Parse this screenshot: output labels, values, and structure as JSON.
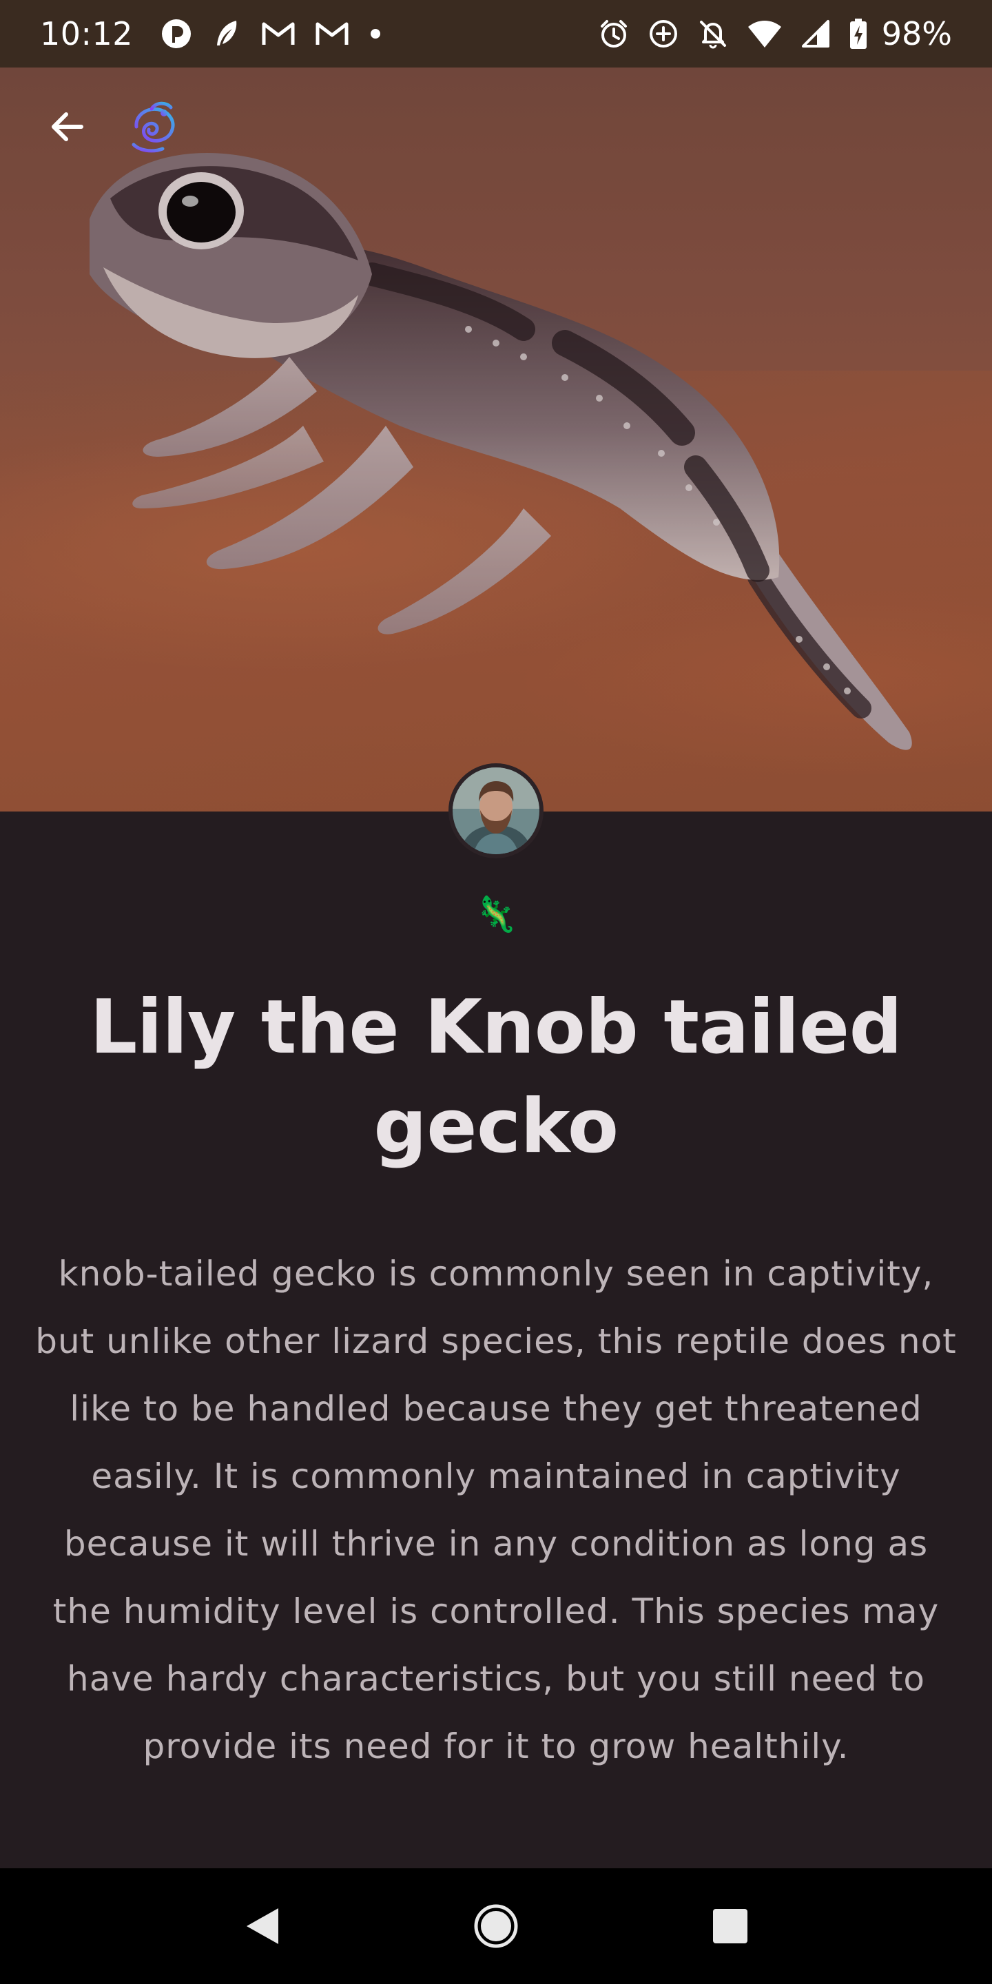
{
  "status_bar": {
    "time": "10:12",
    "battery_percent": "98%",
    "left_icons": [
      "brand-app-icon",
      "feather-icon",
      "gmail-icon",
      "gmail-icon",
      "notification-dot-icon"
    ],
    "right_icons": [
      "alarm-icon",
      "data-saver-icon",
      "notifications-off-icon",
      "wifi-icon",
      "cell-signal-icon",
      "battery-charging-icon"
    ]
  },
  "hero": {
    "back_icon": "arrow-back-icon",
    "logo_icon": "chameleon-logo-icon"
  },
  "post": {
    "emoji": "🦎",
    "title": "Lily the Knob tailed gecko",
    "body": "knob-tailed gecko is commonly seen in captivity, but unlike other lizard species, this reptile does not like to be handled because they get threatened easily. It is commonly maintained in captivity because it will thrive in any condition as long as the humidity level is controlled. This species may have hardy characteristics, but you still need to provide its need for it to grow healthily."
  },
  "nav_bar": {
    "back": "nav-back-icon",
    "home": "nav-home-icon",
    "recents": "nav-recents-icon"
  },
  "colors": {
    "status_bar_bg": "#3a2b20",
    "content_bg": "#241c20",
    "title_text": "#e9e3e6",
    "body_text": "#bdb4b8",
    "nav_bar_bg": "#000000"
  }
}
